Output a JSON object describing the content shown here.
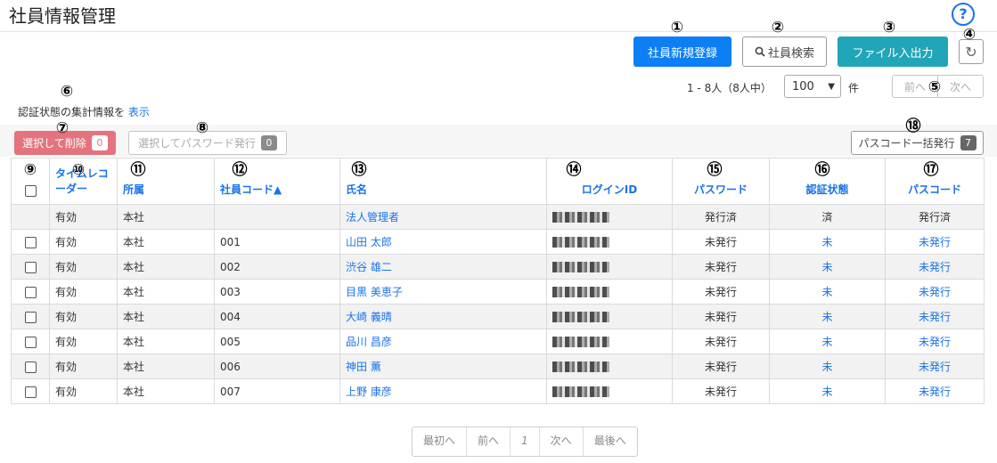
{
  "app": {
    "title": "社員情報管理",
    "help_icon": "?"
  },
  "toolbar": {
    "register": "社員新規登録",
    "search": "社員検索",
    "search_icon": "search-icon",
    "file_io": "ファイル入出力",
    "refresh_icon": "↻"
  },
  "paging_top": {
    "count_text": "1 - 8人（8人中）",
    "per_page": "100",
    "per_page_unit": "件",
    "prev": "前へ",
    "next": "次へ"
  },
  "auth_summary": {
    "text": "認証状態の集計情報を",
    "link": "表示"
  },
  "actions": {
    "delete_label": "選択して削除",
    "delete_count": "0",
    "pw_issue_label": "選択してパスワード発行",
    "pw_issue_count": "0",
    "passcode_bulk_label": "パスコード一括発行",
    "passcode_bulk_count": "7"
  },
  "annotations": [
    "①",
    "②",
    "③",
    "④",
    "⑤",
    "⑥",
    "⑦",
    "⑧",
    "⑨",
    "⑩",
    "⑪",
    "⑫",
    "⑬",
    "⑭",
    "⑮",
    "⑯",
    "⑰",
    "⑱"
  ],
  "table": {
    "headers": {
      "timerecorder": "タイムレコーダー",
      "dept": "所属",
      "code": "社員コード▲",
      "name": "氏名",
      "login": "ログインID",
      "password": "パスワード",
      "auth": "認証状態",
      "passcode": "パスコード"
    },
    "rows": [
      {
        "status": "有効",
        "dept": "本社",
        "code": "",
        "name": "法人管理者",
        "password": "発行済",
        "auth": "済",
        "passcode": "発行済"
      },
      {
        "status": "有効",
        "dept": "本社",
        "code": "001",
        "name": "山田 太郎",
        "password": "未発行",
        "auth": "未",
        "passcode": "未発行"
      },
      {
        "status": "有効",
        "dept": "本社",
        "code": "002",
        "name": "渋谷 雄二",
        "password": "未発行",
        "auth": "未",
        "passcode": "未発行"
      },
      {
        "status": "有効",
        "dept": "本社",
        "code": "003",
        "name": "目黒 美恵子",
        "password": "未発行",
        "auth": "未",
        "passcode": "未発行"
      },
      {
        "status": "有効",
        "dept": "本社",
        "code": "004",
        "name": "大崎 義晴",
        "password": "未発行",
        "auth": "未",
        "passcode": "未発行"
      },
      {
        "status": "有効",
        "dept": "本社",
        "code": "005",
        "name": "品川 昌彦",
        "password": "未発行",
        "auth": "未",
        "passcode": "未発行"
      },
      {
        "status": "有効",
        "dept": "本社",
        "code": "006",
        "name": "神田 薫",
        "password": "未発行",
        "auth": "未",
        "passcode": "未発行"
      },
      {
        "status": "有効",
        "dept": "本社",
        "code": "007",
        "name": "上野 康彦",
        "password": "未発行",
        "auth": "未",
        "passcode": "未発行"
      }
    ]
  },
  "pager": {
    "first": "最初へ",
    "prev": "前へ",
    "page": "1",
    "next": "次へ",
    "last": "最後へ"
  },
  "colors": {
    "primary": "#0d7ff5",
    "info": "#21a5b8",
    "danger": "#e4737d",
    "link": "#1a73e8"
  }
}
